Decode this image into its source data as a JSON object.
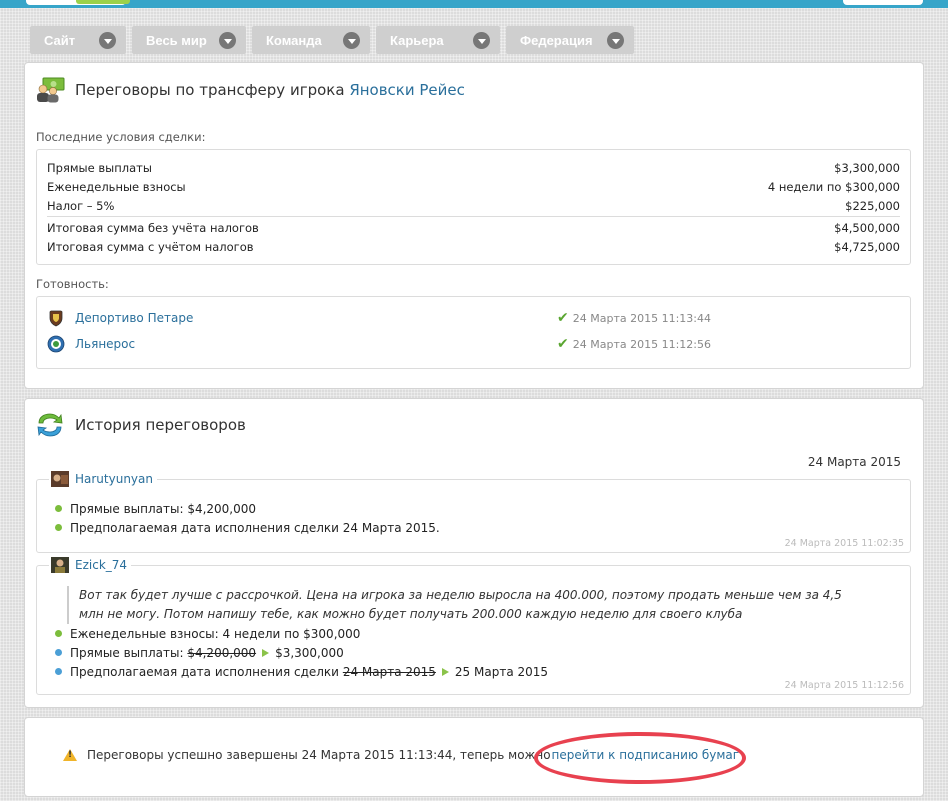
{
  "nav": {
    "items": [
      {
        "label": "Сайт"
      },
      {
        "label": "Весь мир"
      },
      {
        "label": "Команда"
      },
      {
        "label": "Карьера"
      },
      {
        "label": "Федерация"
      }
    ]
  },
  "transfer": {
    "title_prefix": "Переговоры по трансферу игрока",
    "player_name": "Яновски Рейес",
    "last_terms_label": "Последние условия сделки:",
    "terms": [
      {
        "label": "Прямые выплаты",
        "value": "$3,300,000"
      },
      {
        "label": "Еженедельные взносы",
        "value": "4 недели по $300,000"
      },
      {
        "label": "Налог – 5%",
        "value": "$225,000"
      }
    ],
    "totals": [
      {
        "label": "Итоговая сумма без учёта налогов",
        "value": "$4,500,000"
      },
      {
        "label": "Итоговая сумма с учётом налогов",
        "value": "$4,725,000"
      }
    ],
    "readiness_label": "Готовность:",
    "readiness": [
      {
        "club": "Депортиво Петаре",
        "timestamp": "24 Марта 2015 11:13:44"
      },
      {
        "club": "Льянерос",
        "timestamp": "24 Марта 2015 11:12:56"
      }
    ]
  },
  "history": {
    "title": "История переговоров",
    "date": "24 Марта 2015",
    "messages": [
      {
        "user": "Harutyunyan",
        "lines": [
          {
            "text": "Прямые выплаты: $4,200,000"
          },
          {
            "text": "Предполагаемая дата исполнения сделки 24 Марта 2015."
          }
        ],
        "timestamp": "24 Марта 2015 11:02:35"
      },
      {
        "user": "Ezick_74",
        "quote": "Вот так будет лучше с рассрочкой. Цена на игрока за неделю выросла на 400.000, поэтому продать меньше чем за 4,5 млн не могу. Потом напишу тебе, как можно будет получать 200.000 каждую неделю для своего клуба",
        "weekly": "Еженедельные взносы: 4 недели по $300,000",
        "direct_prefix": "Прямые выплаты:",
        "direct_old": "$4,200,000",
        "direct_new": "$3,300,000",
        "date_prefix": "Предполагаемая дата исполнения сделки",
        "date_old": "24 Марта 2015",
        "date_new": "25 Марта 2015",
        "timestamp": "24 Марта 2015 11:12:56"
      }
    ]
  },
  "footer": {
    "message": "Переговоры успешно завершены 24 Марта 2015 11:13:44, теперь можно",
    "link": "перейти к подписанию бумаг"
  },
  "colors": {
    "link": "#2a6f9b",
    "top_bar": "#37a5c9",
    "highlight_oval": "#e8414f",
    "bullet_green": "#7cbd3c",
    "bullet_blue": "#4b9fd6"
  }
}
